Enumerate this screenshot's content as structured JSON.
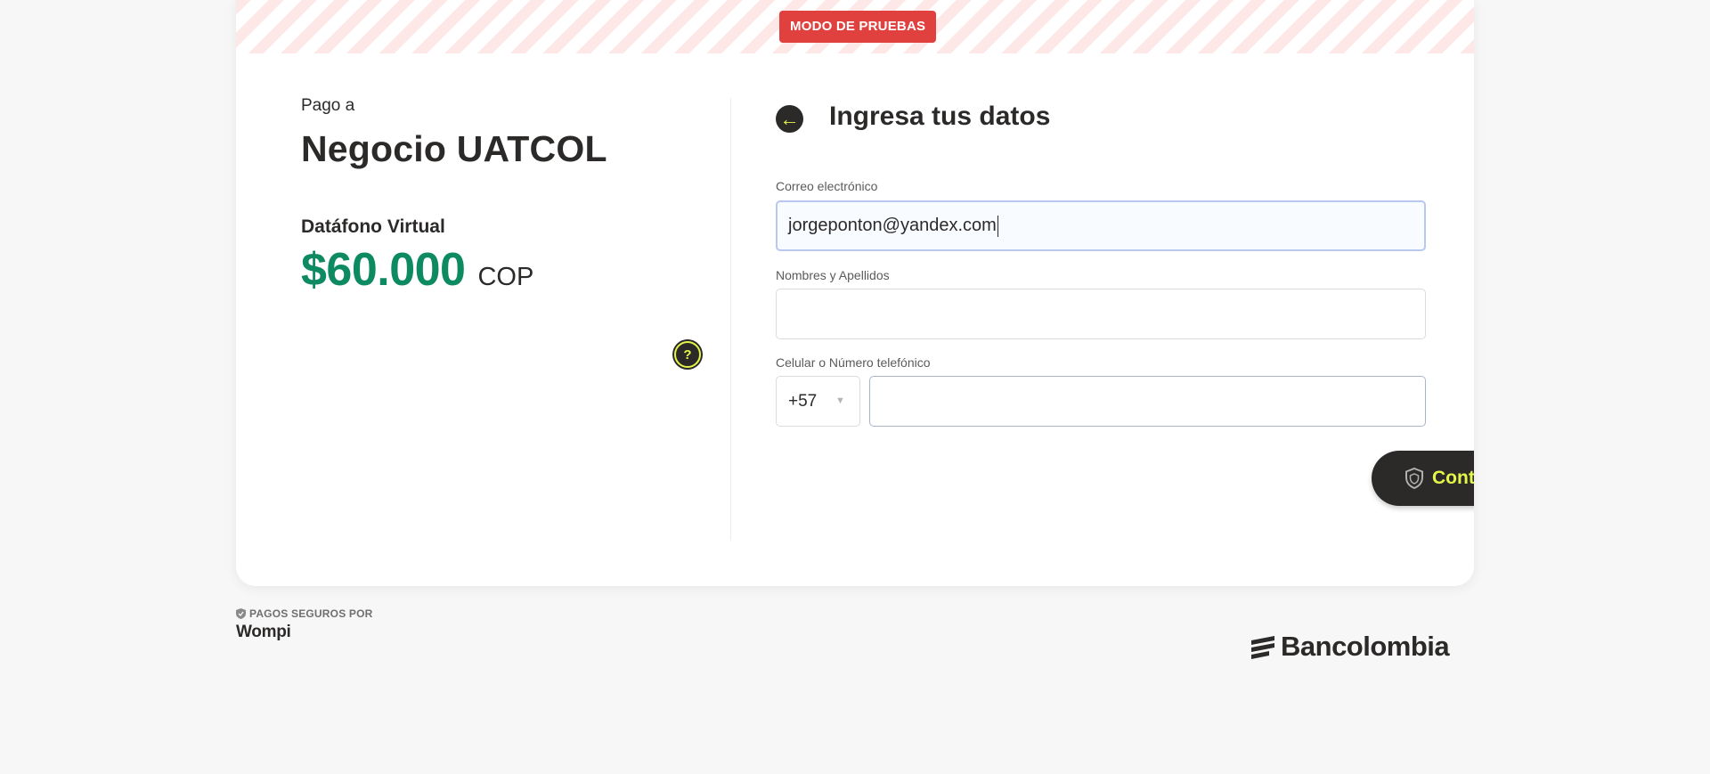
{
  "banner": {
    "label": "MODO DE PRUEBAS"
  },
  "summary": {
    "pay_to": "Pago a",
    "merchant": "Negocio UATCOL",
    "product": "Datáfono Virtual",
    "amount": "$60.000",
    "currency": "COP",
    "help_icon_glyph": "?"
  },
  "form": {
    "title": "Ingresa tus datos",
    "email_label": "Correo electrónico",
    "email_value": "jorgeponton@yandex.com",
    "name_label": "Nombres y Apellidos",
    "name_value": "",
    "phone_label": "Celular o Número telefónico",
    "phone_prefix": "+57",
    "phone_value": "",
    "submit_label": "Continuar con tu pago"
  },
  "footer": {
    "secure_text": "PAGOS SEGUROS POR",
    "wompi": "Wompi",
    "bancolombia": "Bancolombia"
  },
  "colors": {
    "accent_yellow": "#e4f64a",
    "dark": "#2c2a29",
    "amount_green": "#0d8a61",
    "badge_red": "#e0413f"
  },
  "icons": [
    "back-arrow-icon",
    "help-icon",
    "chevron-down-icon",
    "shield-icon",
    "bancolombia-logo-icon"
  ]
}
